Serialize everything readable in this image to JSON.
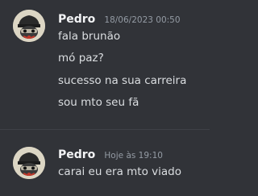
{
  "groups": [
    {
      "username": "Pedro",
      "timestamp": "18/06/2023 00:50",
      "avatar_icon": "pepe-hat-avatar",
      "lines": [
        "fala brunão",
        "mó paz?",
        "sucesso na sua carreira",
        "sou mto seu fã"
      ]
    },
    {
      "username": "Pedro",
      "timestamp": "Hoje às 19:10",
      "avatar_icon": "pepe-hat-avatar",
      "lines": [
        "carai eu era mto viado"
      ]
    }
  ],
  "colors": {
    "background": "#313338",
    "username": "#f2f3f5",
    "timestamp": "#949ba4",
    "message": "#dbdee1"
  }
}
